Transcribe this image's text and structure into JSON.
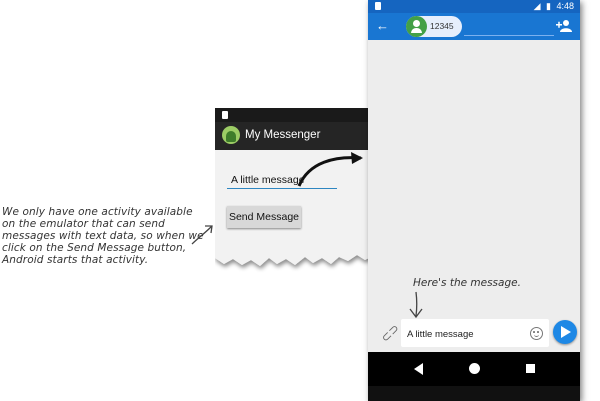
{
  "annotation": {
    "text_lines": [
      "We only have one activity available",
      "on the emulator that can send",
      "messages with text data, so when we",
      "click on the Send Message button,",
      "Android starts that activity."
    ]
  },
  "small_app": {
    "title": "My Messenger",
    "input_value": "A little message",
    "button_label": "Send Message"
  },
  "phone": {
    "status_time": "4:48",
    "recipient": "12345",
    "compose_text": "A little message",
    "accent_color": "#1976d2"
  },
  "captions": {
    "heres": "Here's the message."
  }
}
